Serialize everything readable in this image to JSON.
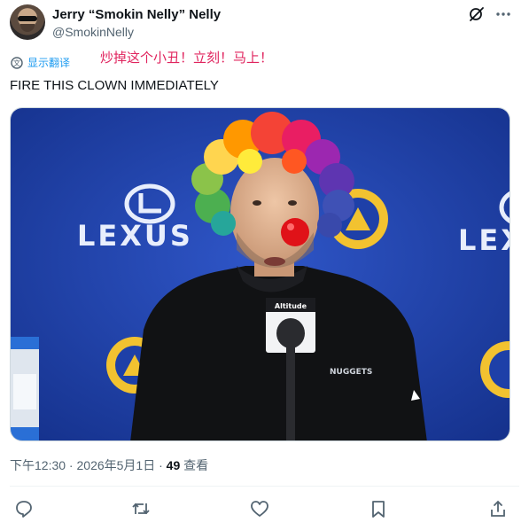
{
  "author": {
    "display_name": "Jerry “Smokin Nelly” Nelly",
    "handle": "@SmokinNelly"
  },
  "translate": {
    "label": "显示翻译",
    "translated_text": "炒掉这个小丑！立刻！马上！"
  },
  "tweet": {
    "text": "FIRE THIS CLOWN IMMEDIATELY"
  },
  "media": {
    "backdrop_sponsor": "LEXUS",
    "shirt_text": "NUGGETS",
    "mic_flag": "Altitude"
  },
  "meta": {
    "time": "下午12:30",
    "separator": " · ",
    "date": "2026年5月1日",
    "views_count": "49",
    "views_label": " 查看"
  },
  "icons": {
    "header": [
      "grok-icon",
      "more-icon"
    ],
    "actions": [
      "reply-icon",
      "retweet-icon",
      "like-icon",
      "bookmark-icon",
      "share-icon"
    ]
  },
  "colors": {
    "link": "#1d9bf0",
    "muted": "#536471",
    "translation_red": "#e0245e",
    "backdrop_blue": "#1e40a8",
    "nuggets_gold": "#f2c230"
  }
}
